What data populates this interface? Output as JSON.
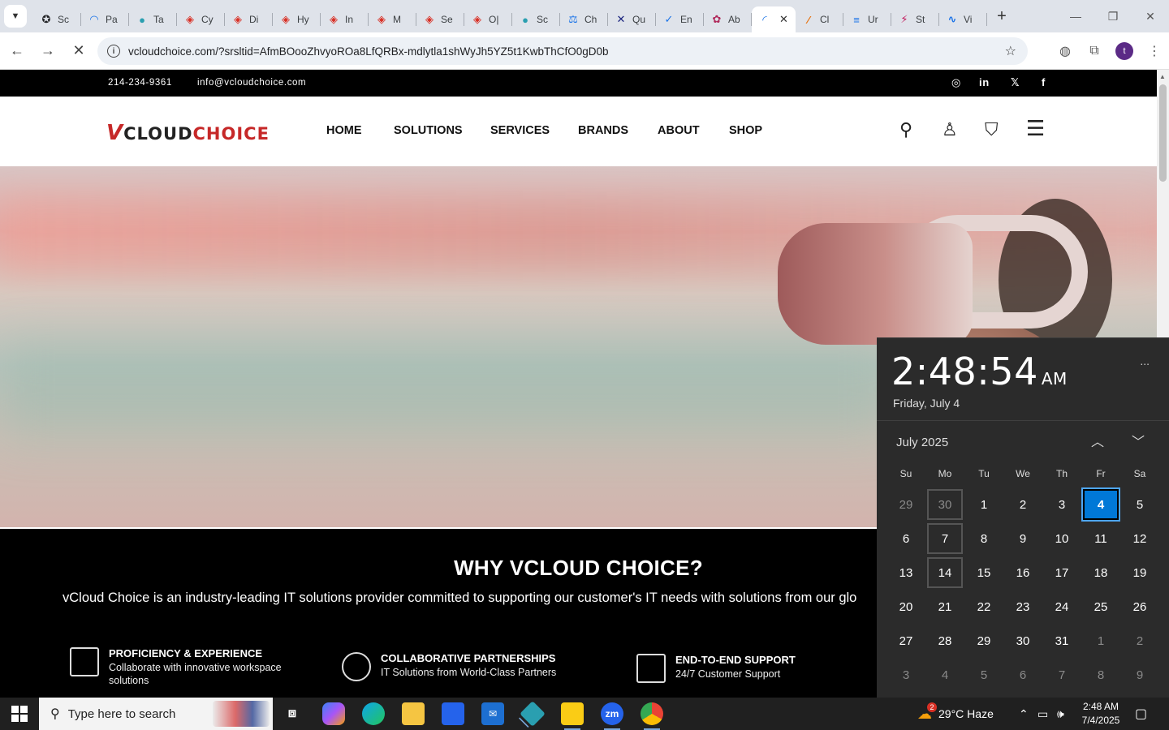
{
  "browser": {
    "tabs": [
      {
        "label": "Sc",
        "color": "#202124",
        "glyph": "✪"
      },
      {
        "label": "Pa",
        "color": "#1a73e8",
        "glyph": "◠"
      },
      {
        "label": "Ta",
        "color": "#2a9fb0",
        "glyph": "●"
      },
      {
        "label": "Cy",
        "color": "#d93025",
        "glyph": "◈"
      },
      {
        "label": "Di",
        "color": "#d93025",
        "glyph": "◈"
      },
      {
        "label": "Hy",
        "color": "#d93025",
        "glyph": "◈"
      },
      {
        "label": "In",
        "color": "#d93025",
        "glyph": "◈"
      },
      {
        "label": "M",
        "color": "#d93025",
        "glyph": "◈"
      },
      {
        "label": "Se",
        "color": "#d93025",
        "glyph": "◈"
      },
      {
        "label": "O|",
        "color": "#d93025",
        "glyph": "◈"
      },
      {
        "label": "Sc",
        "color": "#2a9fb0",
        "glyph": "●"
      },
      {
        "label": "Ch",
        "color": "#1a73e8",
        "glyph": "⚖"
      },
      {
        "label": "Qu",
        "color": "#1a237e",
        "glyph": "✕"
      },
      {
        "label": "En",
        "color": "#1a73e8",
        "glyph": "✓"
      },
      {
        "label": "Ab",
        "color": "#b0285a",
        "glyph": "✿"
      }
    ],
    "active_tab": {
      "label": "",
      "close": "✕"
    },
    "tabs_after": [
      {
        "label": "Cl",
        "color": "#e8710a",
        "glyph": "∕"
      },
      {
        "label": "Ur",
        "color": "#1a73e8",
        "glyph": "≡"
      },
      {
        "label": "St",
        "color": "#c2185b",
        "glyph": "⚡"
      },
      {
        "label": "Vi",
        "color": "#1a73e8",
        "glyph": "∿"
      }
    ],
    "new_tab": "+",
    "url": "vcloudchoice.com/?srsltid=AfmBOooZhvyoROa8LfQRBx-mdlytla1shWyJh5YZ5t1KwbThCfO0gD0b",
    "profile_initial": "t"
  },
  "site": {
    "phone": "214-234-9361",
    "email": "info@vcloudchoice.com",
    "logo": {
      "v": "V",
      "cloud": "CLOUD",
      "choice": "CHOICE"
    },
    "nav": [
      "HOME",
      "SOLUTIONS",
      "SERVICES",
      "BRANDS",
      "ABOUT",
      "SHOP"
    ],
    "why_title": "WHY VCLOUD CHOICE?",
    "why_desc": "vCloud Choice is an industry-leading IT solutions provider committed to supporting our customer's IT needs with solutions from our glo",
    "features": [
      {
        "title": "PROFICIENCY & EXPERIENCE",
        "sub": "Collaborate with innovative workspace solutions"
      },
      {
        "title": "COLLABORATIVE PARTNERSHIPS",
        "sub": "IT Solutions from World-Class Partners"
      },
      {
        "title": "END-TO-END SUPPORT",
        "sub": "24/7 Customer Support"
      }
    ]
  },
  "calendar": {
    "time": "2:48:54",
    "ampm": "AM",
    "date": "Friday, July 4",
    "more": "...",
    "month": "July 2025",
    "weekdays": [
      "Su",
      "Mo",
      "Tu",
      "We",
      "Th",
      "Fr",
      "Sa"
    ],
    "weeks": [
      [
        "29",
        "30",
        "1",
        "2",
        "3",
        "4",
        "5"
      ],
      [
        "6",
        "7",
        "8",
        "9",
        "10",
        "11",
        "12"
      ],
      [
        "13",
        "14",
        "15",
        "16",
        "17",
        "18",
        "19"
      ],
      [
        "20",
        "21",
        "22",
        "23",
        "24",
        "25",
        "26"
      ],
      [
        "27",
        "28",
        "29",
        "30",
        "31",
        "1",
        "2"
      ],
      [
        "3",
        "4",
        "5",
        "6",
        "7",
        "8",
        "9"
      ]
    ],
    "today": "4"
  },
  "taskbar": {
    "search_placeholder": "Type here to search",
    "weather": "29°C  Haze",
    "weather_badge": "2",
    "time": "2:48 AM",
    "date": "7/4/2025"
  }
}
